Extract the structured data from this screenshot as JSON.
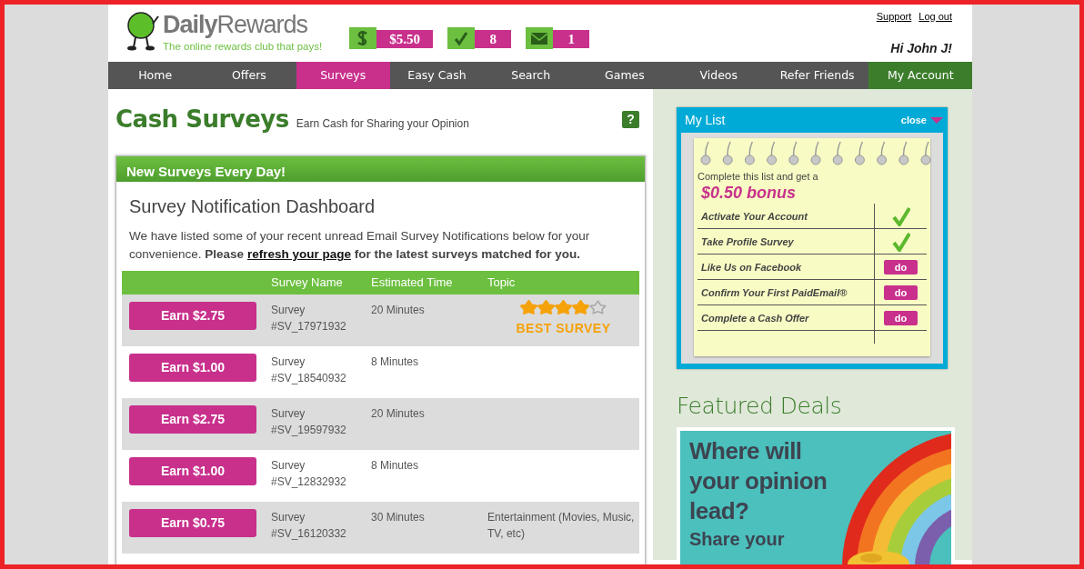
{
  "logo": {
    "name": "**Daily**Rewards",
    "tagline": "The online rewards club that pays!"
  },
  "stats": [
    {
      "kind": "cash",
      "value": "$5.50"
    },
    {
      "kind": "check",
      "value": "8"
    },
    {
      "kind": "mail",
      "value": "1"
    }
  ],
  "top_links": [
    "Support",
    "Log out"
  ],
  "greeting": "Hi John J!",
  "nav": [
    {
      "label": "Home",
      "selected": false
    },
    {
      "label": "Offers",
      "selected": false
    },
    {
      "label": "Surveys",
      "selected": true
    },
    {
      "label": "Easy Cash",
      "selected": false
    },
    {
      "label": "Search",
      "selected": false
    },
    {
      "label": "Games",
      "selected": false
    },
    {
      "label": "Videos",
      "selected": false
    },
    {
      "label": "Refer Friends",
      "selected": false
    },
    {
      "label": "My Account",
      "selected": false,
      "kind": "account"
    }
  ],
  "page": {
    "title": "Cash Surveys",
    "subtitle": "Earn Cash for Sharing your Opinion",
    "help": "?"
  },
  "panel": {
    "header": "New Surveys Every Day!",
    "title": "Survey Notification Dashboard",
    "intro": "We have listed some of your recent unread Email Survey Notifications below for your convenience. **Please** ",
    "link": "refresh your page",
    "intro_end": " **for the latest surveys matched for you.**"
  },
  "table": {
    "columns": [
      "Survey Name",
      "Estimated Time",
      "Topic"
    ],
    "rows": [
      {
        "button": "Earn $2.75",
        "name": "Survey #SV_17971932",
        "time": "20 Minutes",
        "stars": 4,
        "badge": "BEST SURVEY"
      },
      {
        "button": "Earn $1.00",
        "name": "Survey #SV_18540932",
        "time": "8 Minutes"
      },
      {
        "button": "Earn $2.75",
        "name": "Survey #SV_19597932",
        "time": "20 Minutes"
      },
      {
        "button": "Earn $1.00",
        "name": "Survey #SV_12832932",
        "time": "8 Minutes"
      },
      {
        "button": "Earn $0.75",
        "name": "Survey #SV_16120332",
        "time": "30 Minutes",
        "topic": "Entertainment (Movies, Music, TV, etc)"
      }
    ]
  },
  "my_list": {
    "title": "My List",
    "close": "close",
    "lead": "Complete this list and get a",
    "bonus": "$0.50 bonus",
    "items": [
      {
        "label": "Activate Your Account",
        "done": true
      },
      {
        "label": "Take Profile Survey",
        "done": true
      },
      {
        "label": "Like Us on Facebook",
        "done": false,
        "action": "do"
      },
      {
        "label": "Confirm Your First PaidEmail®",
        "done": false,
        "action": "do"
      },
      {
        "label": "Complete a Cash Offer",
        "done": false,
        "action": "do"
      }
    ]
  },
  "featured": {
    "title": "Featured Deals",
    "ad_headline": "Where will your opinion lead?",
    "ad_text": "Share your"
  }
}
